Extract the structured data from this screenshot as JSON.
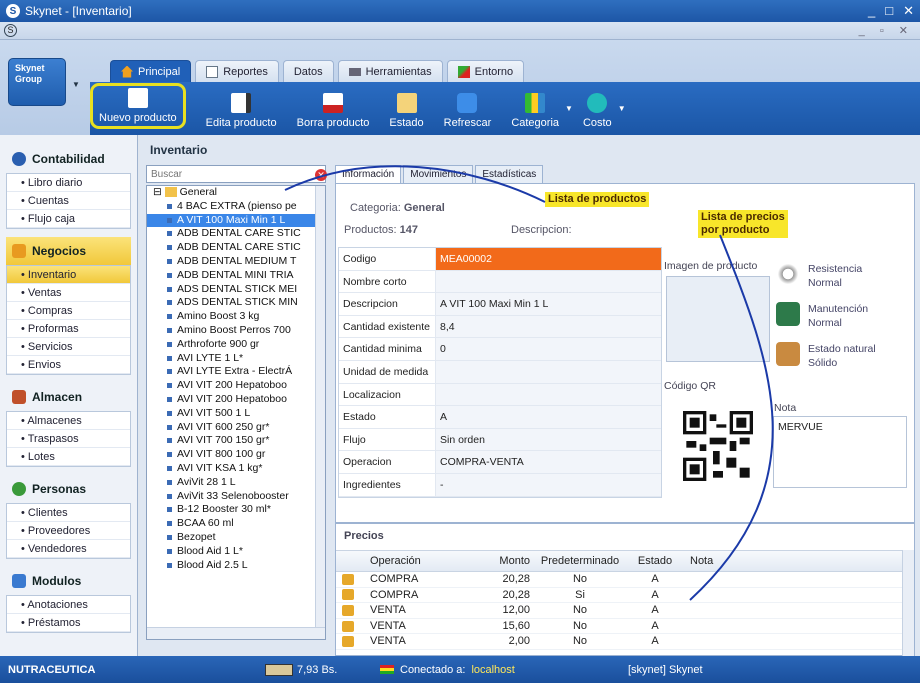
{
  "window": {
    "title": "Skynet - [Inventario]",
    "logo": "S"
  },
  "app": {
    "button_label": "Skynet Group"
  },
  "tabs": [
    {
      "label": "Principal",
      "icon": "home-icon"
    },
    {
      "label": "Reportes",
      "icon": "report-icon"
    },
    {
      "label": "Datos",
      "icon": ""
    },
    {
      "label": "Herramientas",
      "icon": "tools-icon"
    },
    {
      "label": "Entorno",
      "icon": "pen-icon"
    }
  ],
  "toolbar": {
    "nuevo": "Nuevo producto",
    "edita": "Edita producto",
    "borra": "Borra producto",
    "estado": "Estado",
    "refrescar": "Refrescar",
    "categoria": "Categoria",
    "costo": "Costo"
  },
  "nav": {
    "contabilidad": {
      "label": "Contabilidad",
      "items": [
        "Libro diario",
        "Cuentas",
        "Flujo caja"
      ]
    },
    "negocios": {
      "label": "Negocios",
      "items": [
        "Inventario",
        "Ventas",
        "Compras",
        "Proformas",
        "Servicios",
        "Envios"
      ]
    },
    "almacen": {
      "label": "Almacen",
      "items": [
        "Almacenes",
        "Traspasos",
        "Lotes"
      ]
    },
    "personas": {
      "label": "Personas",
      "items": [
        "Clientes",
        "Proveedores",
        "Vendedores"
      ]
    },
    "modulos": {
      "label": "Modulos",
      "items": [
        "Anotaciones",
        "Préstamos"
      ]
    }
  },
  "inventario": {
    "title": "Inventario",
    "search_placeholder": "Buscar",
    "tree_root": "General",
    "products": [
      "4 BAC EXTRA (pienso pe",
      "A VIT 100 Maxi Min 1 L",
      "ADB DENTAL CARE STIC",
      "ADB DENTAL CARE STIC",
      "ADB DENTAL MEDIUM T",
      "ADB DENTAL MINI TRIA",
      "ADS DENTAL STICK MEI",
      "ADS DENTAL STICK MIN",
      "Amino Boost 3 kg",
      "Amino Boost Perros 700",
      "Arthroforte 900 gr",
      "AVI LYTE 1 L*",
      "AVI LYTE Extra - ElectrÁ",
      "AVI VIT 200 Hepatoboo",
      "AVI VIT 200 Hepatoboo",
      "AVI VIT 500 1 L",
      "AVI VIT 600 250 gr*",
      "AVI VIT 700 150 gr*",
      "AVI VIT 800 100 gr",
      "AVI VIT KSA 1 kg*",
      "AviVit 28 1 L",
      "AviVit 33 Selenobooster",
      "B-12 Booster 30 ml*",
      "BCAA 60 ml",
      "Bezopet",
      "Blood Aid 1 L*",
      "Blood Aid 2.5 L"
    ]
  },
  "detail": {
    "tabs": [
      "Información",
      "Movimientos",
      "Estadísticas"
    ],
    "categoria_label": "Categoria:",
    "categoria_value": "General",
    "productos_label": "Productos:",
    "productos_value": "147",
    "descripcion_label": "Descripcion:",
    "props": [
      {
        "k": "Codigo",
        "v": "MEA00002"
      },
      {
        "k": "Nombre corto",
        "v": ""
      },
      {
        "k": "Descripcion",
        "v": "A VIT 100 Maxi Min 1 L"
      },
      {
        "k": "Cantidad existente",
        "v": "8,4"
      },
      {
        "k": "Cantidad minima",
        "v": "0"
      },
      {
        "k": "Unidad de medida",
        "v": ""
      },
      {
        "k": "Localizacion",
        "v": ""
      },
      {
        "k": "Estado",
        "v": "A"
      },
      {
        "k": "Flujo",
        "v": "Sin orden"
      },
      {
        "k": "Operacion",
        "v": "COMPRA-VENTA"
      },
      {
        "k": "Ingredientes",
        "v": "-"
      }
    ],
    "imagen_label": "Imagen de producto",
    "qr_label": "Código QR",
    "status": [
      {
        "t": "Resistencia",
        "s": "Normal",
        "icon": "loading-icon"
      },
      {
        "t": "Manutención",
        "s": "Normal",
        "icon": "landscape-icon"
      },
      {
        "t": "Estado natural",
        "s": "Sólido",
        "icon": "box-icon"
      }
    ],
    "nota_label": "Nota",
    "nota_value": "MERVUE"
  },
  "precios": {
    "title": "Precios",
    "headers": [
      "Operación",
      "Monto",
      "Predeterminado",
      "Estado",
      "Nota"
    ],
    "rows": [
      [
        "COMPRA",
        "20,28",
        "No",
        "A",
        ""
      ],
      [
        "COMPRA",
        "20,28",
        "Si",
        "A",
        ""
      ],
      [
        "VENTA",
        "12,00",
        "No",
        "A",
        ""
      ],
      [
        "VENTA",
        "15,60",
        "No",
        "A",
        ""
      ],
      [
        "VENTA",
        "2,00",
        "No",
        "A",
        ""
      ]
    ]
  },
  "annotations": {
    "lista_productos": "Lista de productos",
    "lista_precios_1": "Lista de precios",
    "lista_precios_2": "por producto"
  },
  "statusbar": {
    "empresa": "NUTRACEUTICA",
    "tasa": "7,93 Bs.",
    "conectado_label": "Conectado a:",
    "conectado_host": "localhost",
    "usuario": "[skynet] Skynet"
  },
  "colors": {
    "accent": "#1d56a6",
    "highlight": "#f8e62a",
    "code_bg": "#f26a1a",
    "selected": "#3a86e8"
  }
}
